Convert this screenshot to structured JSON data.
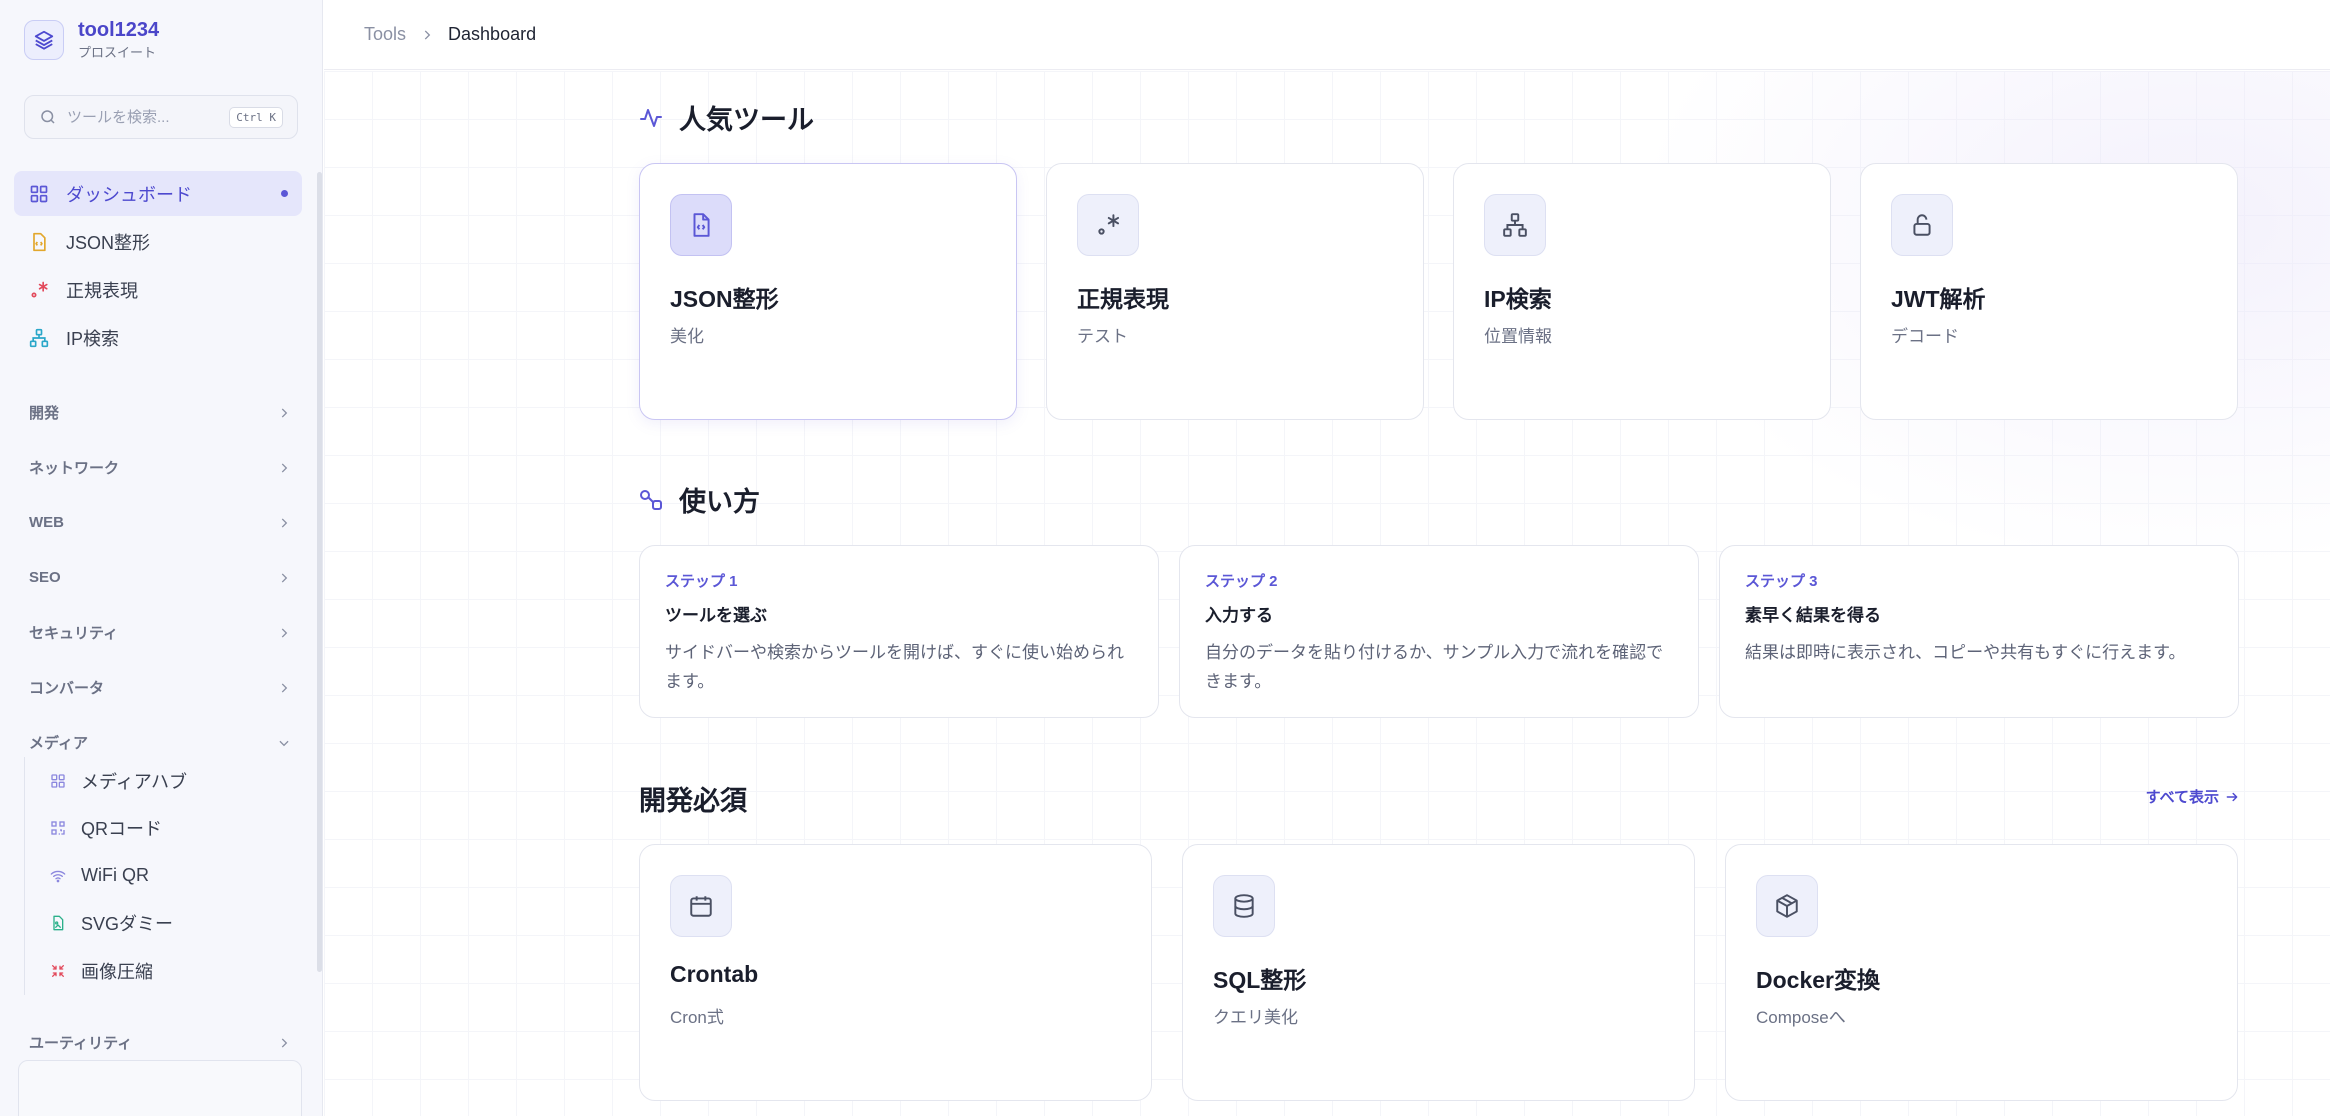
{
  "brand": {
    "name": "tool1234",
    "sub": "プロスイート"
  },
  "search": {
    "placeholder": "ツールを検索...",
    "shortcut": "Ctrl K"
  },
  "nav": {
    "items": [
      {
        "label": "ダッシュボード",
        "icon": "grid-icon"
      },
      {
        "label": "JSON整形",
        "icon": "json-file-icon"
      },
      {
        "label": "正規表現",
        "icon": "regex-icon"
      },
      {
        "label": "IP検索",
        "icon": "network-icon"
      }
    ]
  },
  "categories": [
    "開発",
    "ネットワーク",
    "WEB",
    "SEO",
    "セキュリティ",
    "コンバータ",
    "メディア"
  ],
  "media_items": [
    {
      "label": "メディアハブ",
      "icon": "grid-icon"
    },
    {
      "label": "QRコード",
      "icon": "qr-icon"
    },
    {
      "label": "WiFi QR",
      "icon": "wifi-icon"
    },
    {
      "label": "SVGダミー",
      "icon": "image-file-icon"
    },
    {
      "label": "画像圧縮",
      "icon": "compress-icon"
    }
  ],
  "category_utility": "ユーティリティ",
  "breadcrumb": {
    "root": "Tools",
    "current": "Dashboard"
  },
  "popular": {
    "title": "人気ツール",
    "cards": [
      {
        "name": "JSON整形",
        "sub": "美化",
        "icon": "json-file-icon"
      },
      {
        "name": "正規表現",
        "sub": "テスト",
        "icon": "regex-icon"
      },
      {
        "name": "IP検索",
        "sub": "位置情報",
        "icon": "network-icon"
      },
      {
        "name": "JWT解析",
        "sub": "デコード",
        "icon": "unlock-icon"
      }
    ]
  },
  "howto": {
    "title": "使い方",
    "steps": [
      {
        "no": "ステップ 1",
        "title": "ツールを選ぶ",
        "desc": "サイドバーや検索からツールを開けば、すぐに使い始められます。"
      },
      {
        "no": "ステップ 2",
        "title": "入力する",
        "desc": "自分のデータを貼り付けるか、サンプル入力で流れを確認できます。"
      },
      {
        "no": "ステップ 3",
        "title": "素早く結果を得る",
        "desc": "結果は即時に表示され、コピーや共有もすぐに行えます。"
      }
    ]
  },
  "dev": {
    "title": "開発必須",
    "see_all": "すべて表示",
    "cards": [
      {
        "name": "Crontab",
        "sub": "Cron式",
        "icon": "calendar-icon"
      },
      {
        "name": "SQL整形",
        "sub": "クエリ美化",
        "icon": "database-icon"
      },
      {
        "name": "Docker変換",
        "sub": "Composeへ",
        "icon": "box-icon"
      }
    ]
  },
  "colors": {
    "accent": "#5b57d6",
    "accent_bg": "#e5e6fb"
  }
}
